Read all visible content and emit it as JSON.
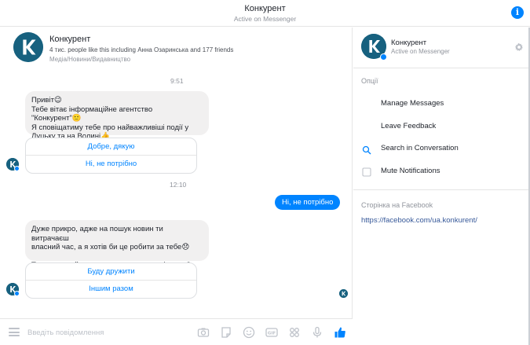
{
  "topbar": {
    "title": "Конкурент",
    "subtitle": "Active on Messenger",
    "info_icon": "info-icon"
  },
  "page_card": {
    "name": "Конкурент",
    "likes": "4 тис. people like this including Анна Озаринська and 177 friends",
    "category": "Медіа/Новини/Видавництво"
  },
  "messages": [
    {
      "time": "9:51",
      "text": "Привіт😉\nТебе вітає інформаційне агентство \"Конкурент\"🙂\nЯ сповіщатиму тебе про найважливіші події у\nЛуцьку та на Волині👍",
      "quick_replies": [
        "Добре, дякую",
        "Ні, не потрібно"
      ]
    },
    {
      "time": "12:10",
      "outgoing": "Ні, не потрібно"
    },
    {
      "text": "Дуже прикро, адже на пошук новин ти витрачаєш\nвласний час, а я хотів би це робити за тебе😞\n\nТи впевнений, що не хочеш дружити зі мною?",
      "quick_replies": [
        "Буду дружити",
        "Іншим разом"
      ]
    }
  ],
  "composer": {
    "placeholder": "Введіть повідомлення",
    "icons": [
      "menu-icon",
      "camera-icon",
      "sticker-icon",
      "emoji-icon",
      "gif-icon",
      "games-icon",
      "microphone-icon",
      "like-icon"
    ]
  },
  "sidebar": {
    "name": "Конкурент",
    "status": "Active on Messenger",
    "options_title": "Опції",
    "options": [
      "Manage Messages",
      "Leave Feedback",
      "Search in Conversation",
      "Mute Notifications"
    ],
    "fb_section_title": "Сторінка на Facebook",
    "fb_link": "https://facebook.com/ua.konkurent/"
  },
  "colors": {
    "accent": "#0084ff",
    "brand": "#17617f",
    "bubble_in": "#f1f0f0",
    "link": "#365899",
    "muted": "#90949c"
  }
}
